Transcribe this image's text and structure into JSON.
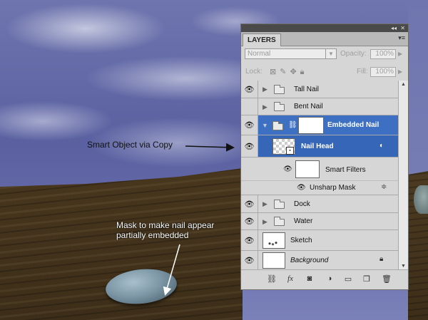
{
  "annotations": {
    "smart_object": "Smart Object via Copy",
    "mask_line1": "Mask to make nail appear",
    "mask_line2": "partially embedded"
  },
  "panel": {
    "tab_label": "LAYERS",
    "blend_mode": "Normal",
    "opacity_label": "Opacity:",
    "opacity_value": "100%",
    "lock_label": "Lock:",
    "fill_label": "Fill:",
    "fill_value": "100%"
  },
  "layers": [
    {
      "name": "Tall Nail",
      "type": "group"
    },
    {
      "name": "Bent Nail",
      "type": "group"
    },
    {
      "name": "Embedded Nail",
      "type": "group",
      "expanded": true,
      "selected": true
    },
    {
      "name": "Nail Head",
      "type": "smart-object",
      "selected": true
    },
    {
      "name": "Smart Filters",
      "type": "filter-mask"
    },
    {
      "name": "Unsharp Mask",
      "type": "filter"
    },
    {
      "name": "Dock",
      "type": "group"
    },
    {
      "name": "Water",
      "type": "group"
    },
    {
      "name": "Sketch",
      "type": "layer"
    },
    {
      "name": "Background",
      "type": "background",
      "locked": true
    }
  ],
  "icons": {
    "visibility": "eye-icon",
    "group": "folder-icon",
    "link": "chain-link-icon",
    "lock": "lock-icon",
    "footer": [
      "link-layers-icon",
      "fx-icon",
      "mask-icon",
      "adjustment-icon",
      "new-group-icon",
      "new-layer-icon",
      "trash-icon"
    ]
  },
  "colors": {
    "selection": "#3d6fc2",
    "panel_bg": "#d6d6d6"
  }
}
